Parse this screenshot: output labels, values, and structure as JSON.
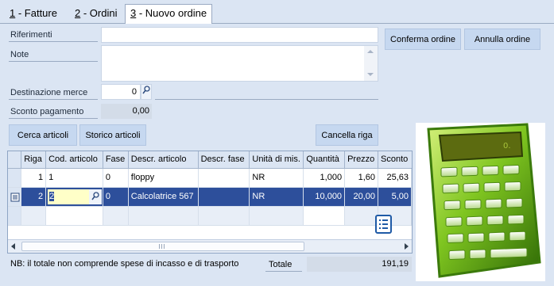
{
  "tabs": [
    {
      "key": "1",
      "label": " - Fatture"
    },
    {
      "key": "2",
      "label": " - Ordini"
    },
    {
      "key": "3",
      "label": " - Nuovo ordine"
    }
  ],
  "form": {
    "riferimenti_label": "Riferimenti",
    "riferimenti_value": "",
    "note_label": "Note",
    "note_value": "",
    "destinazione_label": "Destinazione merce",
    "destinazione_value": "0",
    "sconto_label": "Sconto pagamento",
    "sconto_value": "0,00"
  },
  "buttons": {
    "conferma": "Conferma ordine",
    "annulla": "Annulla ordine",
    "cerca": "Cerca articoli",
    "storico": "Storico articoli",
    "cancella": "Cancella riga"
  },
  "grid": {
    "headers": [
      "Riga",
      "Cod. articolo",
      "Fase",
      "Descr. articolo",
      "Descr. fase",
      "Unità di mis.",
      "Quantità",
      "Prezzo",
      "Sconto"
    ],
    "rows": [
      [
        "1",
        "1",
        "0",
        "floppy",
        "",
        "NR",
        "1,000",
        "1,60",
        "25,63"
      ],
      [
        "2",
        "2",
        "0",
        "Calcolatrice 567",
        "",
        "NR",
        "10,000",
        "20,00",
        "5,00"
      ]
    ]
  },
  "footer": {
    "note": "NB: il totale non comprende spese di incasso e di trasporto",
    "totale_label": "Totale",
    "totale_value": "191,19"
  },
  "calculator": {
    "display": "0."
  },
  "colors": {
    "selection": "#2d4f9b",
    "panel": "#dbe5f3",
    "button": "#c6d8f0",
    "calc_green": "#6bbf1a"
  }
}
